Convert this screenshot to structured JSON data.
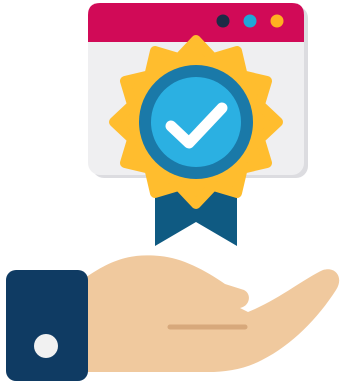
{
  "illustration": {
    "icon_name": "verified-badge-on-hand-icon",
    "window": {
      "frame_color": "#d10a57",
      "body_color": "#efeff1",
      "shadow_color": "#dcdce0",
      "controls": [
        {
          "name": "close-dot-icon",
          "color": "#1d2b46"
        },
        {
          "name": "minimize-dot-icon",
          "color": "#20a7d8"
        },
        {
          "name": "maximize-dot-icon",
          "color": "#ffb120"
        }
      ]
    },
    "badge": {
      "icon_name": "checkmark-icon",
      "burst_color": "#ffbd2e",
      "outer_ring_color": "#1a79a8",
      "inner_circle_color": "#2bb0e2",
      "check_color": "#ffffff",
      "ribbon_color": "#0f5a82",
      "ribbon_dark_color": "#0b4a6c"
    },
    "hand": {
      "icon_name": "open-hand-icon",
      "skin_color": "#f0c99e",
      "crease_color": "#d7a87b",
      "cuff_color": "#0f3b63",
      "button_color": "#f1f1f1"
    }
  }
}
